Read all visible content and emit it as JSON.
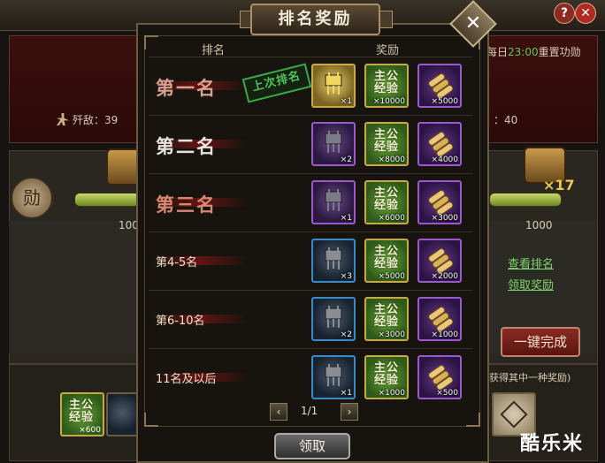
{
  "modal": {
    "title": "排名奖励",
    "close_glyph": "✕",
    "header_rank": "排名",
    "header_reward": "奖励",
    "last_rank_stamp": "上次排名",
    "rows": [
      {
        "rank": "第一名",
        "items": [
          {
            "kind": "vessel",
            "rarity": "gold",
            "count": "×1"
          },
          {
            "kind": "exp",
            "rarity": "gold",
            "label_top": "主公",
            "label_bottom": "经验",
            "count": "×10000"
          },
          {
            "kind": "scroll",
            "rarity": "purple",
            "count": "×5000"
          }
        ]
      },
      {
        "rank": "第二名",
        "items": [
          {
            "kind": "vessel",
            "rarity": "purple",
            "count": "×2"
          },
          {
            "kind": "exp",
            "rarity": "gold",
            "label_top": "主公",
            "label_bottom": "经验",
            "count": "×8000"
          },
          {
            "kind": "scroll",
            "rarity": "purple",
            "count": "×4000"
          }
        ]
      },
      {
        "rank": "第三名",
        "items": [
          {
            "kind": "vessel",
            "rarity": "purple",
            "count": "×1"
          },
          {
            "kind": "exp",
            "rarity": "gold",
            "label_top": "主公",
            "label_bottom": "经验",
            "count": "×6000"
          },
          {
            "kind": "scroll",
            "rarity": "purple",
            "count": "×3000"
          }
        ]
      },
      {
        "rank": "第4-5名",
        "items": [
          {
            "kind": "vessel",
            "rarity": "blue",
            "count": "×3"
          },
          {
            "kind": "exp",
            "rarity": "gold",
            "label_top": "主公",
            "label_bottom": "经验",
            "count": "×5000"
          },
          {
            "kind": "scroll",
            "rarity": "purple",
            "count": "×2000"
          }
        ]
      },
      {
        "rank": "第6-10名",
        "items": [
          {
            "kind": "vessel",
            "rarity": "blue",
            "count": "×2"
          },
          {
            "kind": "exp",
            "rarity": "gold",
            "label_top": "主公",
            "label_bottom": "经验",
            "count": "×3000"
          },
          {
            "kind": "scroll",
            "rarity": "purple",
            "count": "×1000"
          }
        ]
      },
      {
        "rank": "11名及以后",
        "items": [
          {
            "kind": "vessel",
            "rarity": "blue",
            "count": "×1"
          },
          {
            "kind": "exp",
            "rarity": "gold",
            "label_top": "主公",
            "label_bottom": "经验",
            "count": "×1000"
          },
          {
            "kind": "scroll",
            "rarity": "purple",
            "count": "×500"
          }
        ]
      }
    ],
    "pager": {
      "prev": "‹",
      "next": "›",
      "page": "1/1"
    },
    "claim_button": "领取"
  },
  "background": {
    "help_glyph": "?",
    "close_glyph": "✕",
    "reset_prefix": "每日",
    "reset_time": "23:00",
    "reset_suffix": "重置功勋",
    "kills_label": "歼敌：39",
    "right_stat": "：40",
    "medal_glyph": "勋",
    "chest_count": "×17",
    "left_value": "100",
    "right_value": "1000",
    "view_rank_link": "查看排名",
    "claim_reward_link": "领取奖励",
    "one_click_button": "一键完成",
    "bottom_hint": "获得其中一种奖励)",
    "bottom_item_label_top": "主公",
    "bottom_item_label_bottom": "经验",
    "bottom_item_count": "×600",
    "watermark": "酷乐米"
  },
  "colors": {
    "rank1": "#d8a090",
    "rank2": "#e8e4dc",
    "rank3": "#d88870",
    "accent_green": "#4ec45a",
    "link_green": "#7fd46a",
    "rarity_gold": "#c8a848",
    "rarity_purple": "#9a5ac8",
    "rarity_blue": "#3a8ac8"
  }
}
